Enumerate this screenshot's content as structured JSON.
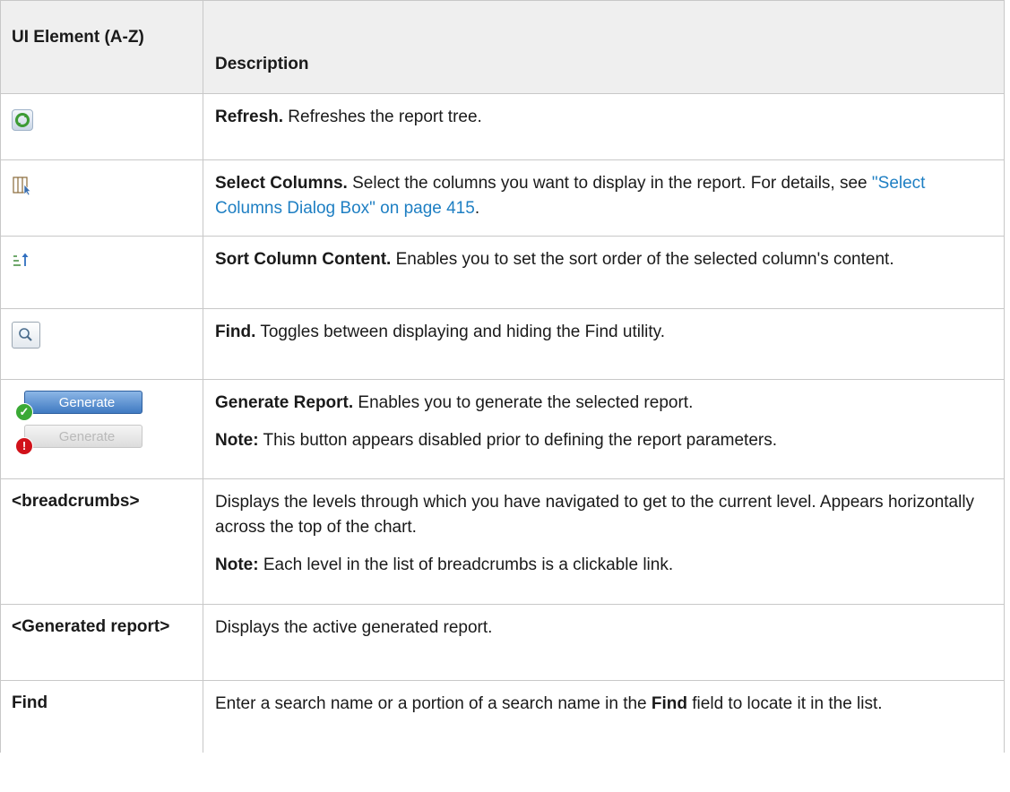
{
  "header": {
    "col_element": "UI Element (A-Z)",
    "col_description": "Description"
  },
  "rows": [
    {
      "icon": "refresh-icon",
      "term": "Refresh.",
      "text": " Refreshes the report tree."
    },
    {
      "icon": "select-columns-icon",
      "term": "Select Columns.",
      "text": " Select the columns you want to display in the report. For details, see ",
      "link": "\"Select Columns Dialog Box\" on page 415",
      "tail": "."
    },
    {
      "icon": "sort-column-content-icon",
      "term": "Sort Column Content.",
      "text": " Enables you to set the sort order of the selected column's content."
    },
    {
      "icon": "find-magnifier-icon",
      "term": "Find.",
      "text": " Toggles between displaying and hiding the Find utility."
    },
    {
      "icon": "generate-buttons",
      "generate_enabled_label": "Generate",
      "generate_disabled_label": "Generate",
      "term": "Generate Report.",
      "text": " Enables you to generate the selected report.",
      "note_label": "Note:",
      "note_text": " This button appears disabled prior to defining the report parameters."
    },
    {
      "element": "<breadcrumbs>",
      "text": "Displays the levels through which you have navigated to get to the current level. Appears horizontally across the top of the chart.",
      "note_label": "Note:",
      "note_text": " Each level in the list of breadcrumbs is a clickable link."
    },
    {
      "element": "<Generated report>",
      "text": "Displays the active generated report."
    },
    {
      "element": "Find",
      "text_before": "Enter a search name or a portion of a search name in the ",
      "bold": "Find",
      "text_after": " field to locate it in the list."
    }
  ],
  "colors": {
    "header_bg": "#efefef",
    "border": "#c8c8c8",
    "link": "#1e7fc3"
  }
}
